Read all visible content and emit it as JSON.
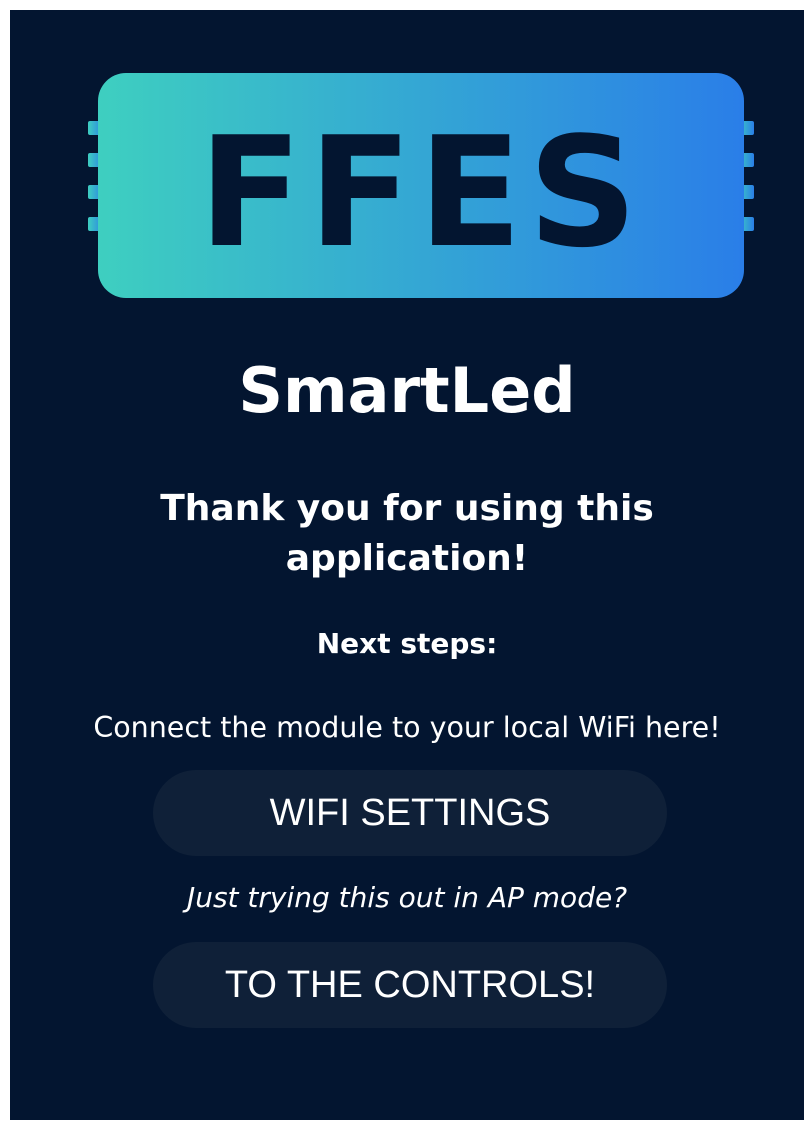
{
  "logo": {
    "text": "FFES",
    "gradient_start": "#3ecfc0",
    "gradient_end": "#2a7ee8",
    "letter_color": "#031530"
  },
  "title": "SmartLed",
  "thanks": "Thank you for using this application!",
  "next_steps": "Next steps:",
  "connect_text": "Connect the module to your local WiFi here!",
  "wifi_button": "WIFI SETTINGS",
  "ap_text": "Just trying this out in AP mode?",
  "controls_button": "TO THE CONTROLS!",
  "colors": {
    "background": "#031530",
    "button_bg": "#0f2038",
    "text": "#ffffff"
  }
}
